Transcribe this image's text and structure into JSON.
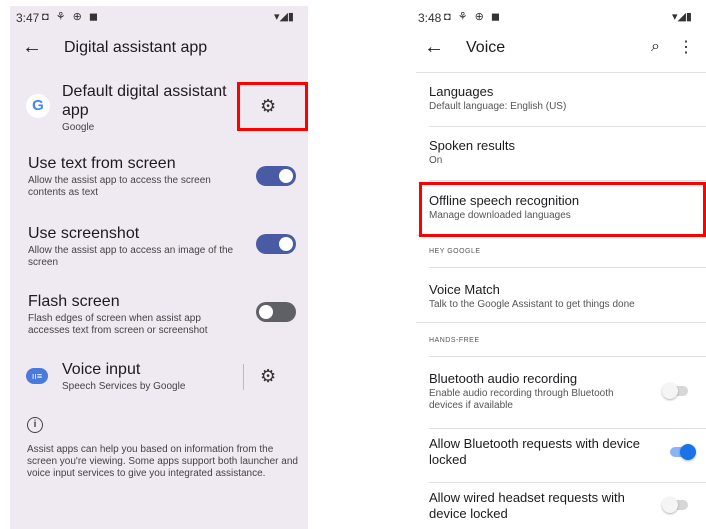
{
  "left": {
    "status": {
      "time": "3:47",
      "icons": "◘ ⚘ ⊕ ◼",
      "system": "▾◢▮"
    },
    "title": "Digital assistant app",
    "default_app": {
      "title": "Default digital assistant app",
      "subtitle": "Google",
      "google_letter": "G"
    },
    "items": [
      {
        "title": "Use text from screen",
        "subtitle": "Allow the assist app to access the screen contents as text",
        "enabled": true
      },
      {
        "title": "Use screenshot",
        "subtitle": "Allow the assist app to access an image of the screen",
        "enabled": true
      },
      {
        "title": "Flash screen",
        "subtitle": "Flash edges of screen when assist app accesses text from screen or screenshot",
        "enabled": false
      }
    ],
    "voice_input": {
      "title": "Voice input",
      "subtitle": "Speech Services by Google"
    },
    "info_text": "Assist apps can help you based on information from the screen you're viewing. Some apps support both launcher and voice input services to give you integrated assistance."
  },
  "right": {
    "status": {
      "time": "3:48",
      "icons": "◘ ⚘ ⊕ ◼",
      "system": "▾◢▮"
    },
    "title": "Voice",
    "languages": {
      "title": "Languages",
      "subtitle": "Default language: English (US)"
    },
    "spoken": {
      "title": "Spoken results",
      "subtitle": "On"
    },
    "offline": {
      "title": "Offline speech recognition",
      "subtitle": "Manage downloaded languages"
    },
    "hey_google_header": "HEY GOOGLE",
    "voice_match": {
      "title": "Voice Match",
      "subtitle": "Talk to the Google Assistant to get things done"
    },
    "hands_free_header": "HANDS-FREE",
    "bluetooth_audio": {
      "title": "Bluetooth audio recording",
      "subtitle": "Enable audio recording through Bluetooth devices if available",
      "enabled": false
    },
    "bluetooth_locked": {
      "title": "Allow Bluetooth requests with device locked",
      "enabled": true
    },
    "wired_locked": {
      "title": "Allow wired headset requests with device locked",
      "enabled": false
    }
  },
  "colors": {
    "toggle_on": "#4a5ba6",
    "toggle_off": "#5f5f66",
    "switch_on": "#1a73e8",
    "highlight": "#ff0000"
  }
}
